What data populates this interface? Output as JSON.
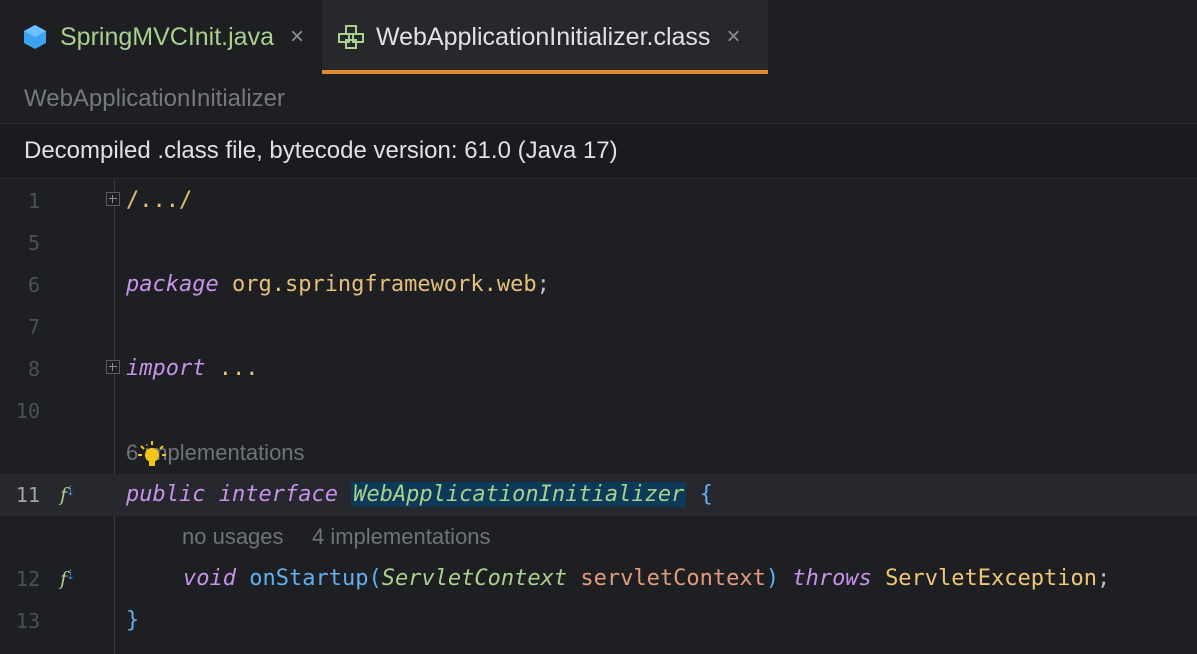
{
  "tabs": [
    {
      "label": "SpringMVCInit.java",
      "icon": "java-class-icon",
      "active": false
    },
    {
      "label": "WebApplicationInitializer.class",
      "icon": "interface-class-icon",
      "active": true
    }
  ],
  "close_glyph": "×",
  "breadcrumb": "WebApplicationInitializer",
  "banner": "Decompiled .class file, bytecode version: 61.0 (Java 17)",
  "hints": {
    "implementations_6": "6 implementations",
    "no_usages": "no usages",
    "implementations_4": "4 implementations"
  },
  "lines": {
    "l1": {
      "num": "1",
      "text": "/.../"
    },
    "l5": {
      "num": "5"
    },
    "l6": {
      "num": "6",
      "kw": "package",
      "pkg": "org.springframework.web",
      "semi": ";"
    },
    "l7": {
      "num": "7"
    },
    "l8": {
      "num": "8",
      "kw": "import",
      "rest": "..."
    },
    "l10": {
      "num": "10"
    },
    "l11": {
      "num": "11",
      "kw1": "public",
      "kw2": "interface",
      "name": "WebApplicationInitializer",
      "brace": "{"
    },
    "l12": {
      "num": "12",
      "kw": "void",
      "method": "onStartup",
      "open": "(",
      "ptype": "ServletContext",
      "pname": "servletContext",
      "close": ")",
      "throws": "throws",
      "exc": "ServletException",
      "semi": ";"
    },
    "l13": {
      "num": "13",
      "brace": "}"
    }
  },
  "gutter_icon_label": "f",
  "colors": {
    "background": "#1e1f22",
    "tab_accent": "#e08b2c",
    "keyword": "#c792ea",
    "class_name": "#a9d08e",
    "highlight": "#0d3a58"
  }
}
